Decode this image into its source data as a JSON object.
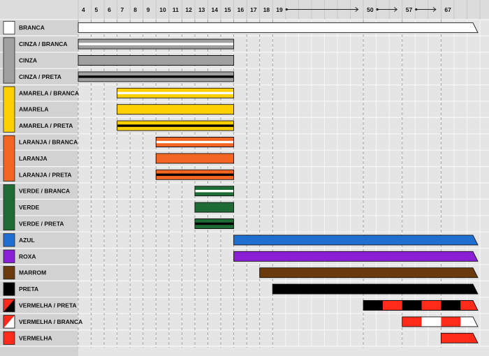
{
  "chart_data": {
    "type": "gantt",
    "title": "",
    "xlabel": "",
    "ylabel": "",
    "x_ticks": [
      "4",
      "5",
      "6",
      "7",
      "8",
      "9",
      "10",
      "11",
      "12",
      "13",
      "14",
      "15",
      "16",
      "17",
      "18",
      "19",
      "50",
      "57",
      "67"
    ],
    "arrow_ticks": [
      "19",
      "50",
      "57"
    ],
    "groups": [
      {
        "name": "branca",
        "swatch": "#ffffff",
        "rows": [
          "BRANCA"
        ]
      },
      {
        "name": "cinza",
        "swatch": "#a0a0a0",
        "rows": [
          "CINZA / BRANCA",
          "CINZA",
          "CINZA / PRETA"
        ]
      },
      {
        "name": "amarela",
        "swatch": "#ffd000",
        "rows": [
          "AMARELA / BRANCA",
          "AMARELA",
          "AMARELA / PRETA"
        ]
      },
      {
        "name": "laranja",
        "swatch": "#f26522",
        "rows": [
          "LARANJA / BRANCA",
          "LARANJA",
          "LARANJA / PRETA"
        ]
      },
      {
        "name": "verde",
        "swatch": "#1e6b35",
        "rows": [
          "VERDE / BRANCA",
          "VERDE",
          "VERDE / PRETA"
        ]
      },
      {
        "name": "azul",
        "swatch": "#1f6fd1",
        "rows": [
          "AZUL"
        ]
      },
      {
        "name": "roxa",
        "swatch": "#8a1fd6",
        "rows": [
          "ROXA"
        ]
      },
      {
        "name": "marrom",
        "swatch": "#6b3a0c",
        "rows": [
          "MARROM"
        ]
      },
      {
        "name": "preta",
        "swatch": "#000000",
        "rows": [
          "PRETA"
        ]
      },
      {
        "name": "vermelha-preta",
        "swatch": "split:#ff2a1a:#000000",
        "rows": [
          "VERMELHA / PRETA"
        ]
      },
      {
        "name": "vermelha-branca",
        "swatch": "split:#ff2a1a:#ffffff",
        "rows": [
          "VERMELHA / BRANCA"
        ]
      },
      {
        "name": "vermelha",
        "swatch": "#ff2a1a",
        "rows": [
          "VERMELHA"
        ]
      }
    ],
    "bars": [
      {
        "row": "BRANCA",
        "start": "4",
        "end": "67+",
        "fill": "#ffffff",
        "stripe": "",
        "open": true
      },
      {
        "row": "CINZA / BRANCA",
        "start": "4",
        "end": "15",
        "fill": "#a0a0a0",
        "stripe": "#ffffff",
        "open": false
      },
      {
        "row": "CINZA",
        "start": "4",
        "end": "15",
        "fill": "#a0a0a0",
        "stripe": "",
        "open": false
      },
      {
        "row": "CINZA / PRETA",
        "start": "4",
        "end": "15",
        "fill": "#a0a0a0",
        "stripe": "#000000",
        "open": false
      },
      {
        "row": "AMARELA / BRANCA",
        "start": "7",
        "end": "15",
        "fill": "#ffd000",
        "stripe": "#ffffff",
        "open": false
      },
      {
        "row": "AMARELA",
        "start": "7",
        "end": "15",
        "fill": "#ffd000",
        "stripe": "",
        "open": false
      },
      {
        "row": "AMARELA / PRETA",
        "start": "7",
        "end": "15",
        "fill": "#ffd000",
        "stripe": "#000000",
        "open": false
      },
      {
        "row": "LARANJA / BRANCA",
        "start": "10",
        "end": "15",
        "fill": "#f26522",
        "stripe": "#ffffff",
        "open": false
      },
      {
        "row": "LARANJA",
        "start": "10",
        "end": "15",
        "fill": "#f26522",
        "stripe": "",
        "open": false
      },
      {
        "row": "LARANJA / PRETA",
        "start": "10",
        "end": "15",
        "fill": "#f26522",
        "stripe": "#000000",
        "open": false
      },
      {
        "row": "VERDE / BRANCA",
        "start": "13",
        "end": "15",
        "fill": "#1e6b35",
        "stripe": "#ffffff",
        "open": false
      },
      {
        "row": "VERDE",
        "start": "13",
        "end": "15",
        "fill": "#1e6b35",
        "stripe": "",
        "open": false
      },
      {
        "row": "VERDE / PRETA",
        "start": "13",
        "end": "15",
        "fill": "#1e6b35",
        "stripe": "#000000",
        "open": false
      },
      {
        "row": "AZUL",
        "start": "16",
        "end": "67+",
        "fill": "#1f6fd1",
        "stripe": "",
        "open": true
      },
      {
        "row": "ROXA",
        "start": "16",
        "end": "67+",
        "fill": "#8a1fd6",
        "stripe": "",
        "open": true
      },
      {
        "row": "MARROM",
        "start": "18",
        "end": "67+",
        "fill": "#6b3a0c",
        "stripe": "",
        "open": true
      },
      {
        "row": "PRETA",
        "start": "19",
        "end": "67+",
        "fill": "#000000",
        "stripe": "",
        "open": true
      },
      {
        "row": "VERMELHA / PRETA",
        "start": "50",
        "end": "67+",
        "fill": "checker",
        "colors": [
          "#000000",
          "#ff2a1a"
        ],
        "open": true
      },
      {
        "row": "VERMELHA / BRANCA",
        "start": "57",
        "end": "67+",
        "fill": "checker",
        "colors": [
          "#ff2a1a",
          "#ffffff"
        ],
        "open": true
      },
      {
        "row": "VERMELHA",
        "start": "67",
        "end": "67+",
        "fill": "#ff2a1a",
        "stripe": "",
        "open": true
      }
    ],
    "grid": true,
    "legend": "left"
  }
}
